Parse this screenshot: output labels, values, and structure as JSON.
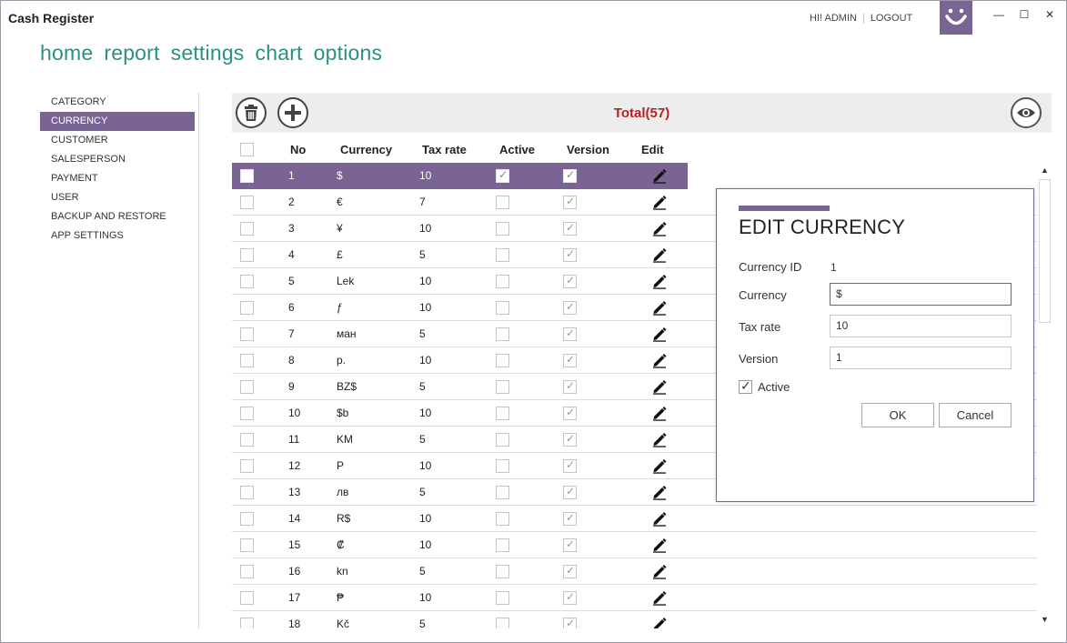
{
  "app": {
    "title": "Cash Register"
  },
  "header": {
    "greeting": "HI! ADMIN",
    "logout": "LOGOUT"
  },
  "window_controls": {
    "minimize": "—",
    "maximize": "☐",
    "close": "✕"
  },
  "nav": {
    "items": [
      "home",
      "report",
      "settings",
      "chart",
      "options"
    ]
  },
  "sidebar": {
    "items": [
      "CATEGORY",
      "CURRENCY",
      "CUSTOMER",
      "SALESPERSON",
      "PAYMENT",
      "USER",
      "BACKUP AND RESTORE",
      "APP SETTINGS"
    ],
    "active": "CURRENCY"
  },
  "toolbar": {
    "total": "Total(57)"
  },
  "table": {
    "columns": [
      "No",
      "Currency",
      "Tax rate",
      "Active",
      "Version",
      "Edit"
    ],
    "rows": [
      {
        "no": "1",
        "currency": "$",
        "tax": "10",
        "active": true,
        "version": true
      },
      {
        "no": "2",
        "currency": "€",
        "tax": "7",
        "active": false,
        "version": true
      },
      {
        "no": "3",
        "currency": "¥",
        "tax": "10",
        "active": false,
        "version": true
      },
      {
        "no": "4",
        "currency": "£",
        "tax": "5",
        "active": false,
        "version": true
      },
      {
        "no": "5",
        "currency": "Lek",
        "tax": "10",
        "active": false,
        "version": true
      },
      {
        "no": "6",
        "currency": "ƒ",
        "tax": "10",
        "active": false,
        "version": true
      },
      {
        "no": "7",
        "currency": "ман",
        "tax": "5",
        "active": false,
        "version": true
      },
      {
        "no": "8",
        "currency": "p.",
        "tax": "10",
        "active": false,
        "version": true
      },
      {
        "no": "9",
        "currency": "BZ$",
        "tax": "5",
        "active": false,
        "version": true
      },
      {
        "no": "10",
        "currency": "$b",
        "tax": "10",
        "active": false,
        "version": true
      },
      {
        "no": "11",
        "currency": "KM",
        "tax": "5",
        "active": false,
        "version": true
      },
      {
        "no": "12",
        "currency": "P",
        "tax": "10",
        "active": false,
        "version": true
      },
      {
        "no": "13",
        "currency": "лв",
        "tax": "5",
        "active": false,
        "version": true
      },
      {
        "no": "14",
        "currency": "R$",
        "tax": "10",
        "active": false,
        "version": true
      },
      {
        "no": "15",
        "currency": "₡",
        "tax": "10",
        "active": false,
        "version": true
      },
      {
        "no": "16",
        "currency": "kn",
        "tax": "5",
        "active": false,
        "version": true
      },
      {
        "no": "17",
        "currency": "₱",
        "tax": "10",
        "active": false,
        "version": true
      },
      {
        "no": "18",
        "currency": "Kč",
        "tax": "5",
        "active": false,
        "version": true
      }
    ],
    "selected_row": 0
  },
  "dialog": {
    "title": "EDIT CURRENCY",
    "currency_id_label": "Currency ID",
    "currency_id_value": "1",
    "currency_label": "Currency",
    "currency_value": "$",
    "tax_label": "Tax rate",
    "tax_value": "10",
    "version_label": "Version",
    "version_value": "1",
    "active_label": "Active",
    "active_checked": true,
    "ok_label": "OK",
    "cancel_label": "Cancel"
  },
  "colors": {
    "accent": "#7a6494",
    "nav": "#2a9080",
    "total": "#b22222"
  },
  "icons": [
    "smiley-logo-icon",
    "trash-icon",
    "plus-icon",
    "eye-icon",
    "pencil-icon",
    "scroll-up-icon",
    "scroll-down-icon"
  ]
}
